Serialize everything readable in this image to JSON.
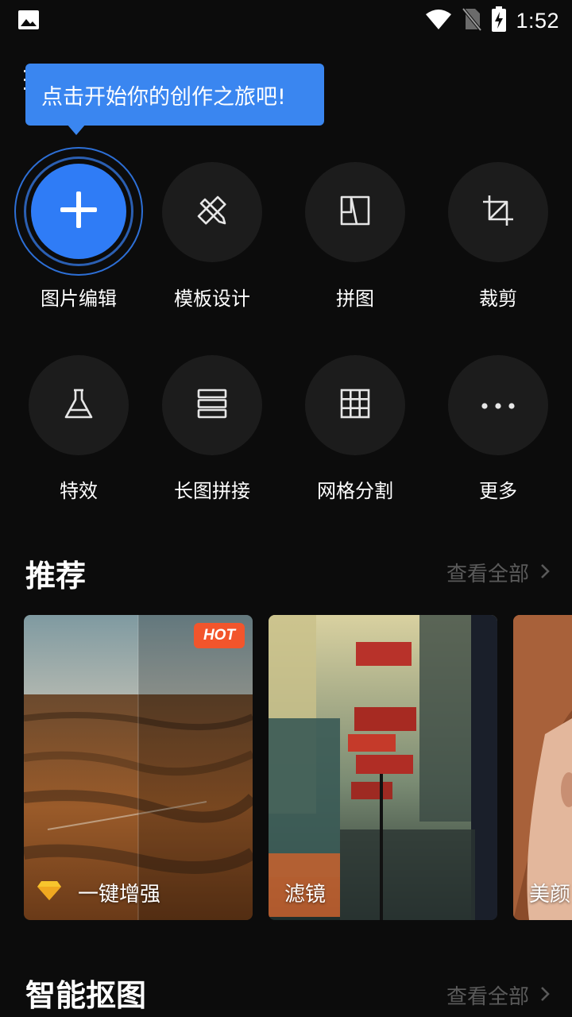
{
  "status_bar": {
    "time": "1:52",
    "icons": [
      "gallery-icon",
      "wifi-icon",
      "no-sim-icon",
      "battery-charging-icon"
    ]
  },
  "tooltip": {
    "text": "点击开始你的创作之旅吧!"
  },
  "tools": [
    {
      "label": "图片编辑",
      "icon": "plus-icon",
      "primary": true
    },
    {
      "label": "模板设计",
      "icon": "design-tools-icon"
    },
    {
      "label": "拼图",
      "icon": "collage-icon"
    },
    {
      "label": "裁剪",
      "icon": "crop-icon"
    },
    {
      "label": "特效",
      "icon": "flask-icon"
    },
    {
      "label": "长图拼接",
      "icon": "stack-icon"
    },
    {
      "label": "网格分割",
      "icon": "grid-icon"
    },
    {
      "label": "更多",
      "icon": "more-icon"
    }
  ],
  "recommend": {
    "title": "推荐",
    "view_all": "查看全部",
    "cards": [
      {
        "label": "一键增强",
        "badge": "HOT",
        "icon": "diamond-icon"
      },
      {
        "label": "滤镜"
      },
      {
        "label": "美颜"
      }
    ]
  },
  "cutout": {
    "title": "智能抠图",
    "view_all": "查看全部"
  },
  "colors": {
    "background": "#0c0c0c",
    "accent": "#2f7cf6",
    "tooltip": "#3a86f0",
    "hot": "#f2552c",
    "muted": "#5a5a5a"
  }
}
